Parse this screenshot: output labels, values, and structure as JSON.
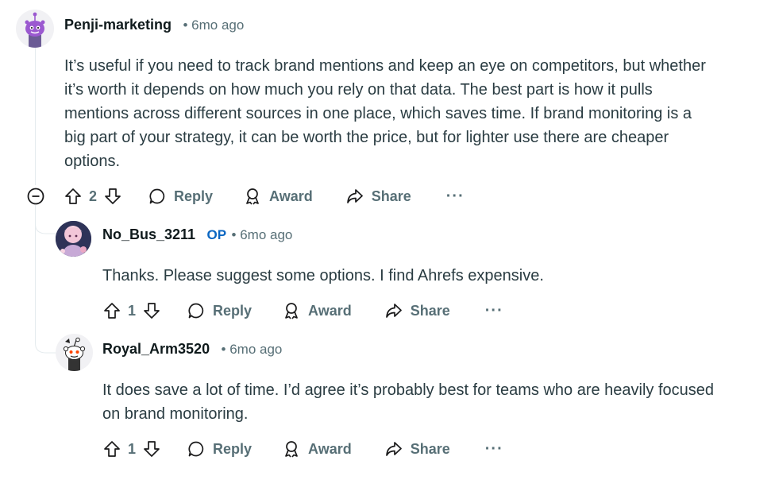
{
  "comments": [
    {
      "author": "Penji-marketing",
      "time": "• 6mo ago",
      "body": [
        "It’s useful if you need to track brand mentions and keep an eye on competitors, but whether",
        "it’s worth it depends on how much you rely on that data. The best part is how it pulls",
        "mentions across different sources in one place, which saves time. If brand monitoring is a",
        "big part of your strategy, it can be worth the price, but for lighter use there are cheaper",
        "options."
      ],
      "votes": "2"
    },
    {
      "author": "No_Bus_3211",
      "badge": "OP",
      "time": "• 6mo ago",
      "body": [
        "Thanks. Please suggest some options. I find Ahrefs expensive."
      ],
      "votes": "1"
    },
    {
      "author": "Royal_Arm3520",
      "time": "• 6mo ago",
      "body": [
        "It does save a lot of time. I’d agree it’s probably best for teams who are heavily focused",
        "on brand monitoring."
      ],
      "votes": "1"
    }
  ],
  "actions": {
    "reply": "Reply",
    "award": "Award",
    "share": "Share",
    "more": "···"
  },
  "colors": {
    "text": "#2a3c42",
    "meta": "#576f76",
    "op": "#0a66c2",
    "thread": "#e5ebee"
  }
}
